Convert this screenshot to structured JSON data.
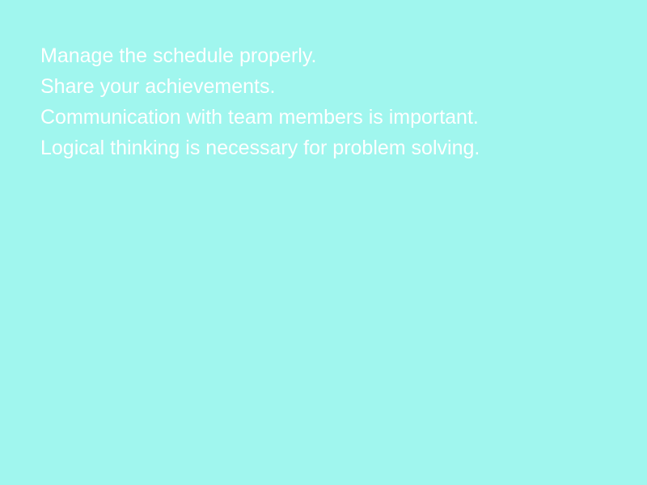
{
  "colors": {
    "background": "#a0f6ee",
    "text": "#ffffff"
  },
  "lines": [
    "Manage the schedule properly.",
    "Share your achievements.",
    "Communication with team members is important.",
    "Logical thinking is necessary for problem solving."
  ]
}
